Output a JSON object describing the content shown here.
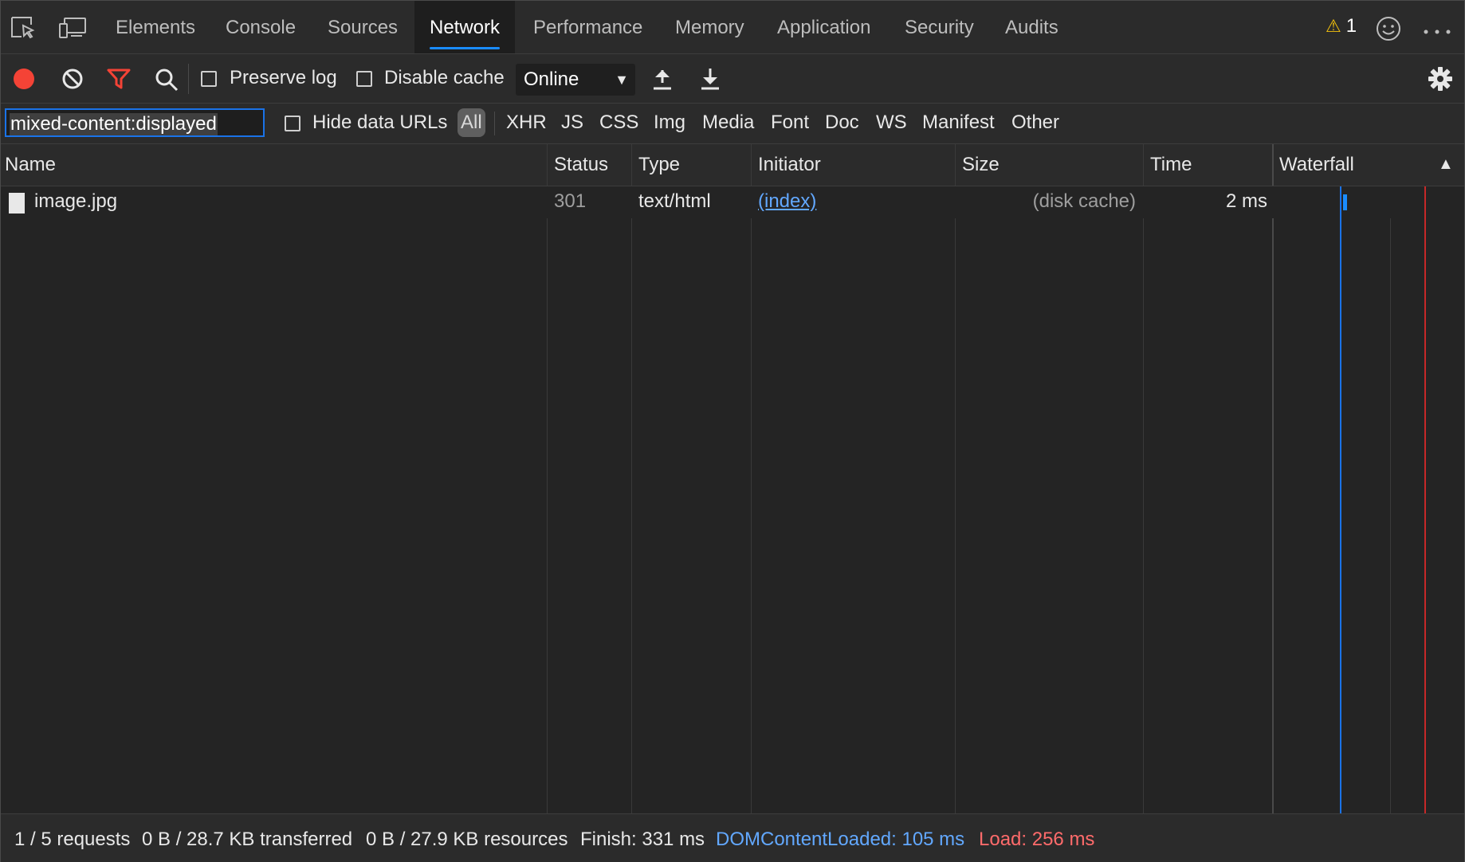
{
  "main_tabs": [
    {
      "label": "Elements"
    },
    {
      "label": "Console"
    },
    {
      "label": "Sources"
    },
    {
      "label": "Network",
      "active": true
    },
    {
      "label": "Performance"
    },
    {
      "label": "Memory"
    },
    {
      "label": "Application"
    },
    {
      "label": "Security"
    },
    {
      "label": "Audits"
    }
  ],
  "warnings": {
    "count": "1"
  },
  "toolbar": {
    "preserve_log": {
      "label": "Preserve log",
      "checked": false
    },
    "disable_cache": {
      "label": "Disable cache",
      "checked": false
    },
    "throttling": {
      "value": "Online"
    }
  },
  "filter": {
    "text": "mixed-content:displayed",
    "hide_data_urls": {
      "label": "Hide data URLs",
      "checked": false
    },
    "types": [
      "All",
      "XHR",
      "JS",
      "CSS",
      "Img",
      "Media",
      "Font",
      "Doc",
      "WS",
      "Manifest",
      "Other"
    ],
    "selected_type": "All"
  },
  "table": {
    "columns": [
      "Name",
      "Status",
      "Type",
      "Initiator",
      "Size",
      "Time",
      "Waterfall"
    ],
    "sort_indicator": "▲",
    "rows": [
      {
        "name": "image.jpg",
        "status": "301",
        "type": "text/html",
        "initiator": "(index)",
        "size": "(disk cache)",
        "time": "2 ms"
      }
    ]
  },
  "status": {
    "requests": "1 / 5 requests",
    "transferred": "0 B / 28.7 KB transferred",
    "resources": "0 B / 27.9 KB resources",
    "finish": "Finish: 331 ms",
    "dcl": "DOMContentLoaded: 105 ms",
    "load": "Load: 256 ms"
  },
  "colors": {
    "accent": "#1a8cff",
    "record": "#f44336",
    "filter_active": "#f44336",
    "dcl_line": "#1a73e8",
    "load_line": "#c62828"
  }
}
